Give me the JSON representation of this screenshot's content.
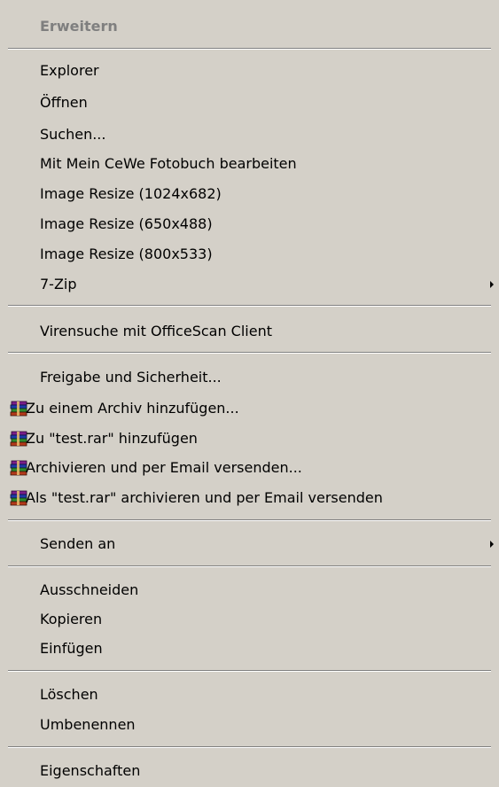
{
  "menu": {
    "items": [
      {
        "label": "Erweitern"
      },
      {
        "label": "Explorer"
      },
      {
        "label": "Öffnen"
      },
      {
        "label": "Suchen..."
      },
      {
        "label": "Mit Mein CeWe Fotobuch bearbeiten"
      },
      {
        "label": "Image Resize (1024x682)"
      },
      {
        "label": "Image Resize (650x488)"
      },
      {
        "label": "Image Resize (800x533)"
      },
      {
        "label": "7-Zip"
      },
      {
        "label": "Virensuche mit OfficeScan Client"
      },
      {
        "label": "Freigabe und Sicherheit..."
      },
      {
        "label": "Zu einem Archiv hinzufügen...",
        "icon": "winrar-icon"
      },
      {
        "label": "Zu \"test.rar\" hinzufügen",
        "icon": "winrar-icon"
      },
      {
        "label": "Archivieren und per Email versenden...",
        "icon": "winrar-icon"
      },
      {
        "label": "Als \"test.rar\" archivieren und per Email versenden",
        "icon": "winrar-icon"
      },
      {
        "label": "Senden an"
      },
      {
        "label": "Ausschneiden"
      },
      {
        "label": "Kopieren"
      },
      {
        "label": "Einfügen"
      },
      {
        "label": "Löschen"
      },
      {
        "label": "Umbenennen"
      },
      {
        "label": "Eigenschaften"
      }
    ]
  },
  "colors": {
    "menu_background": "#d4d0c8",
    "disabled_text": "#7f7f7f",
    "separator_shadow": "#808080",
    "separator_highlight": "#ffffff"
  }
}
